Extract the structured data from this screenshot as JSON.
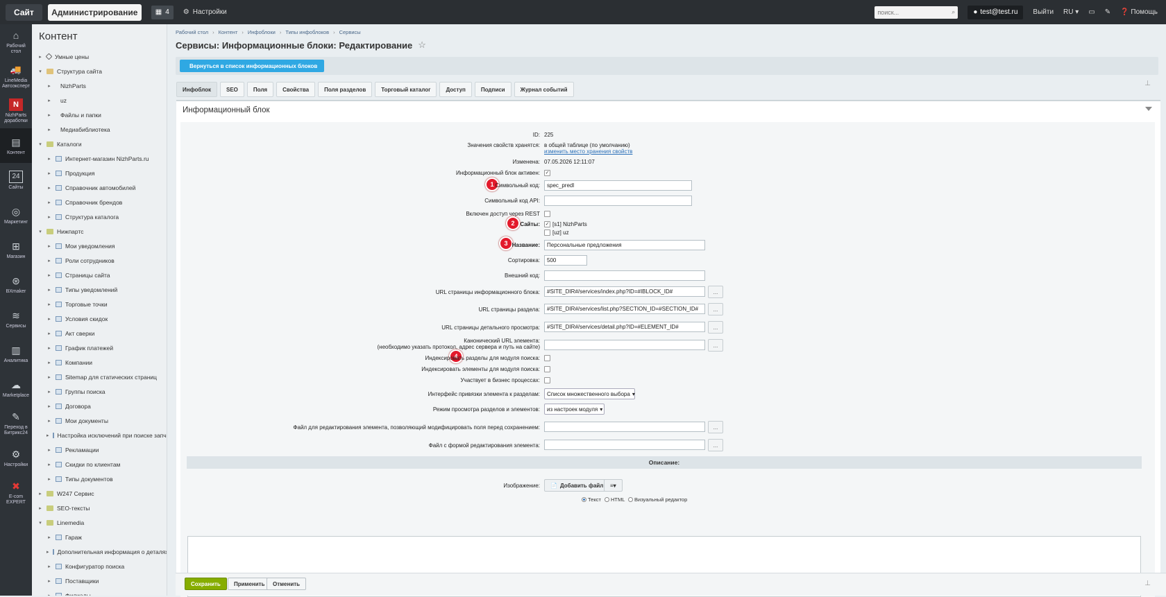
{
  "topbar": {
    "site": "Сайт",
    "admin": "Администрирование",
    "notif_count": "4",
    "settings": "Настройки",
    "search_placeholder": "поиск...",
    "user": "test@test.ru",
    "logout": "Выйти",
    "lang": "RU",
    "help": "Помощь"
  },
  "leftnav": [
    {
      "icon": "home-icon",
      "glyph": "⌂",
      "label1": "Рабочий",
      "label2": "стол"
    },
    {
      "icon": "linemedia-logo",
      "glyph": "🚚",
      "label1": "LineMedia",
      "label2": "Автоэксперт"
    },
    {
      "icon": "nizhparts-logo",
      "glyph": "N",
      "label1": "NizhParts",
      "label2": "доработки"
    },
    {
      "icon": "content-icon",
      "glyph": "▤",
      "label1": "Контент",
      "label2": ""
    },
    {
      "icon": "sites-icon",
      "glyph": "24",
      "label1": "Сайты",
      "label2": ""
    },
    {
      "icon": "marketing-icon",
      "glyph": "◎",
      "label1": "Маркетинг",
      "label2": ""
    },
    {
      "icon": "shop-icon",
      "glyph": "⊞",
      "label1": "Магазин",
      "label2": ""
    },
    {
      "icon": "bxmaker-icon",
      "glyph": "⊛",
      "label1": "BXmaker",
      "label2": ""
    },
    {
      "icon": "services-icon",
      "glyph": "≋",
      "label1": "Сервисы",
      "label2": ""
    },
    {
      "icon": "analytics-icon",
      "glyph": "▥",
      "label1": "Аналитика",
      "label2": ""
    },
    {
      "icon": "marketplace-icon",
      "glyph": "☁",
      "label1": "Marketplace",
      "label2": ""
    },
    {
      "icon": "bitrix24-icon",
      "glyph": "✎",
      "label1": "Переход в",
      "label2": "Битрикс24"
    },
    {
      "icon": "settings-icon",
      "glyph": "⚙",
      "label1": "Настройки",
      "label2": ""
    },
    {
      "icon": "ecom-expert-icon",
      "glyph": "✖",
      "label1": "E-com",
      "label2": "EXPERT"
    }
  ],
  "tree": {
    "title": "Контент",
    "items": [
      {
        "level": 0,
        "arrow": "▸",
        "icon": "tag",
        "label": "Умные цены"
      },
      {
        "level": 0,
        "arrow": "▾",
        "icon": "sitemap",
        "label": "Структура сайта"
      },
      {
        "level": 1,
        "arrow": "▸",
        "icon": "none",
        "label": "NizhParts"
      },
      {
        "level": 1,
        "arrow": "▸",
        "icon": "none",
        "label": "uz"
      },
      {
        "level": 1,
        "arrow": "▸",
        "icon": "none",
        "label": "Файлы и папки"
      },
      {
        "level": 1,
        "arrow": "▸",
        "icon": "none",
        "label": "Медиабиблиотека"
      },
      {
        "level": 0,
        "arrow": "▾",
        "icon": "folder",
        "label": "Каталоги"
      },
      {
        "level": 1,
        "arrow": "▸",
        "icon": "file",
        "label": "Интернет-магазин NizhParts.ru"
      },
      {
        "level": 1,
        "arrow": "▸",
        "icon": "file",
        "label": "Продукция"
      },
      {
        "level": 1,
        "arrow": "▸",
        "icon": "file",
        "label": "Справочник автомобилей"
      },
      {
        "level": 1,
        "arrow": "▸",
        "icon": "file",
        "label": "Справочник брендов"
      },
      {
        "level": 1,
        "arrow": "▸",
        "icon": "file",
        "label": "Структура каталога"
      },
      {
        "level": 0,
        "arrow": "▾",
        "icon": "folder",
        "label": "Нижпартс"
      },
      {
        "level": 1,
        "arrow": "▸",
        "icon": "file",
        "label": "Мои уведомления"
      },
      {
        "level": 1,
        "arrow": "▸",
        "icon": "file",
        "label": "Роли сотрудников"
      },
      {
        "level": 1,
        "arrow": "▸",
        "icon": "file",
        "label": "Страницы сайта"
      },
      {
        "level": 1,
        "arrow": "▸",
        "icon": "file",
        "label": "Типы уведомлений"
      },
      {
        "level": 1,
        "arrow": "▸",
        "icon": "file",
        "label": "Торговые точки"
      },
      {
        "level": 1,
        "arrow": "▸",
        "icon": "file",
        "label": "Условия скидок"
      },
      {
        "level": 1,
        "arrow": "▸",
        "icon": "file",
        "label": "Акт сверки"
      },
      {
        "level": 1,
        "arrow": "▸",
        "icon": "file",
        "label": "График платежей"
      },
      {
        "level": 1,
        "arrow": "▸",
        "icon": "file",
        "label": "Компании"
      },
      {
        "level": 1,
        "arrow": "▸",
        "icon": "file",
        "label": "Sitemap для статических страниц"
      },
      {
        "level": 1,
        "arrow": "▸",
        "icon": "file",
        "label": "Группы поиска"
      },
      {
        "level": 1,
        "arrow": "▸",
        "icon": "file",
        "label": "Договора"
      },
      {
        "level": 1,
        "arrow": "▸",
        "icon": "file",
        "label": "Мои документы"
      },
      {
        "level": 1,
        "arrow": "▸",
        "icon": "file",
        "label": "Настройка исключений при поиске запчаст"
      },
      {
        "level": 1,
        "arrow": "▸",
        "icon": "file",
        "label": "Рекламации"
      },
      {
        "level": 1,
        "arrow": "▸",
        "icon": "file",
        "label": "Скидки по клиентам"
      },
      {
        "level": 1,
        "arrow": "▸",
        "icon": "file",
        "label": "Типы документов"
      },
      {
        "level": 0,
        "arrow": "▸",
        "icon": "folder",
        "label": "W247 Сервис"
      },
      {
        "level": 0,
        "arrow": "▸",
        "icon": "folder",
        "label": "SEO-тексты"
      },
      {
        "level": 0,
        "arrow": "▾",
        "icon": "folder",
        "label": "Linemedia"
      },
      {
        "level": 1,
        "arrow": "▸",
        "icon": "file",
        "label": "Гараж"
      },
      {
        "level": 1,
        "arrow": "▸",
        "icon": "file",
        "label": "Дополнительная информация о деталях"
      },
      {
        "level": 1,
        "arrow": "▸",
        "icon": "file",
        "label": "Конфигуратор поиска"
      },
      {
        "level": 1,
        "arrow": "▸",
        "icon": "file",
        "label": "Поставщики"
      },
      {
        "level": 1,
        "arrow": "▸",
        "icon": "file",
        "label": "Филиалы"
      }
    ]
  },
  "breadcrumb": [
    "Рабочий стол",
    "Контент",
    "Инфоблоки",
    "Типы инфоблоков",
    "Сервисы"
  ],
  "page_title": "Сервисы: Информационные блоки: Редактирование",
  "back_button": "Вернуться в список информационных блоков",
  "tabs": [
    "Инфоблок",
    "SEO",
    "Поля",
    "Свойства",
    "Поля разделов",
    "Торговый каталог",
    "Доступ",
    "Подписи",
    "Журнал событий"
  ],
  "panel_title": "Информационный блок",
  "form": {
    "id_label": "ID:",
    "id_value": "225",
    "storage_label": "Значения свойств хранятся:",
    "storage_value": "в общей таблице (по умолчанию)",
    "storage_link": "изменить место хранения свойств",
    "changed_label": "Изменена:",
    "changed_value": "07.05.2026 12:11:07",
    "active_label": "Информационный блок активен:",
    "code_label": "Символьный код:",
    "code_value": "spec_predl",
    "api_label": "Символьный код API:",
    "api_value": "",
    "rest_label": "Включен доступ через REST",
    "sites_label": "Сайты:",
    "site1": "[s1] NizhParts",
    "site2": "[uz] uz",
    "name_label": "Название:",
    "name_value": "Персональные предложения",
    "sort_label": "Сортировка:",
    "sort_value": "500",
    "ext_label": "Внешний код:",
    "ext_value": "",
    "url_list_label": "URL страницы информационного блока:",
    "url_list_value": "#SITE_DIR#/services/index.php?ID=#IBLOCK_ID#",
    "url_section_label": "URL страницы раздела:",
    "url_section_value": "#SITE_DIR#/services/list.php?SECTION_ID=#SECTION_ID#",
    "url_detail_label": "URL страницы детального просмотра:",
    "url_detail_value": "#SITE_DIR#/services/detail.php?ID=#ELEMENT_ID#",
    "canonical_label": "Канонический URL элемента:",
    "canonical_note": "(необходимо указать протокол, адрес сервера и путь на сайте)",
    "canonical_value": "",
    "idx_sections_label": "Индексировать разделы для модуля поиска:",
    "idx_elements_label": "Индексировать элементы для модуля поиска:",
    "bizproc_label": "Участвует в бизнес процессах:",
    "interface_label": "Интерфейс привязки элемента к разделам:",
    "interface_value": "Список множественного выбора",
    "mode_label": "Режим просмотра разделов и элементов:",
    "mode_value": "из настроек модуля",
    "edit_file_label": "Файл для редактирования элемента, позволяющий модифицировать поля перед сохранением:",
    "edit_file_value": "",
    "form_file_label": "Файл с формой редактирования элемента:",
    "form_file_value": "",
    "btn_dots": "...",
    "desc_section": "Описание:",
    "image_label": "Изображение:",
    "add_file": "Добавить файл",
    "radio_text": "Текст",
    "radio_html": "HTML",
    "radio_visual": "Визуальный редактор"
  },
  "badges": [
    "1",
    "2",
    "3",
    "4"
  ],
  "footer": {
    "save": "Сохранить",
    "apply": "Применить",
    "cancel": "Отменить"
  },
  "colors": {
    "accent": "#2fa8e3",
    "save": "#86ad00",
    "badge": "#e3192b",
    "topbar": "#2b2f33"
  }
}
